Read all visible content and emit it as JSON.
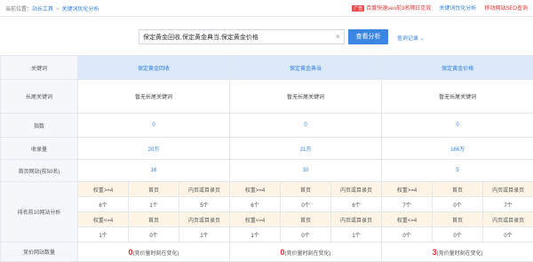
{
  "breadcrumb": {
    "label": "当前位置：",
    "home": "站长工具",
    "sep": ">",
    "current": "关键词优化分析"
  },
  "topright": {
    "badge": "广告",
    "ad_text": "百度快速seo前3名隔日见效",
    "link1": "关键词优化分析",
    "link2": "移动网站SEO查询"
  },
  "search": {
    "value": "保定黄金回收,保定黄金典当,保定黄金价格",
    "button": "查看分析",
    "history": "查询记录",
    "history_icon": "chevron-down"
  },
  "table": {
    "columns": [
      "关键词",
      "保定黄金回收",
      "保定黄金典当",
      "保定黄金价格"
    ],
    "rows": {
      "long_tail": {
        "label": "长尾关键词",
        "values": [
          "暂无长尾关键词",
          "暂无长尾关键词",
          "暂无长尾关键词"
        ]
      },
      "index": {
        "label": "指数",
        "values": [
          "0",
          "0",
          "0"
        ]
      },
      "indexed": {
        "label": "收录量",
        "values": [
          "20万",
          "21万",
          "166万"
        ]
      },
      "homepage": {
        "label": "首页网站(前50名)",
        "values": [
          "16",
          "10",
          "5"
        ]
      }
    },
    "rank_label": "排名前10网站分析",
    "rank_headers_1": [
      "权重>=4",
      "首页",
      "内页或目录页"
    ],
    "rank_values_1": [
      [
        "6个",
        "1个",
        "5个"
      ],
      [
        "6个",
        "0个",
        "6个"
      ],
      [
        "7个",
        "0个",
        "7个"
      ]
    ],
    "rank_headers_2": [
      "权重<=4",
      "首页",
      "内页或目录页"
    ],
    "rank_values_2": [
      [
        "1个",
        "0个",
        "1个"
      ],
      [
        "1个",
        "0个",
        "1个"
      ],
      [
        "0个",
        "0个",
        "0个"
      ]
    ],
    "bid": {
      "label": "竞价网站数量",
      "counts": [
        "0",
        "0",
        "3"
      ],
      "note": "(竞价量时刻在变化)"
    }
  }
}
